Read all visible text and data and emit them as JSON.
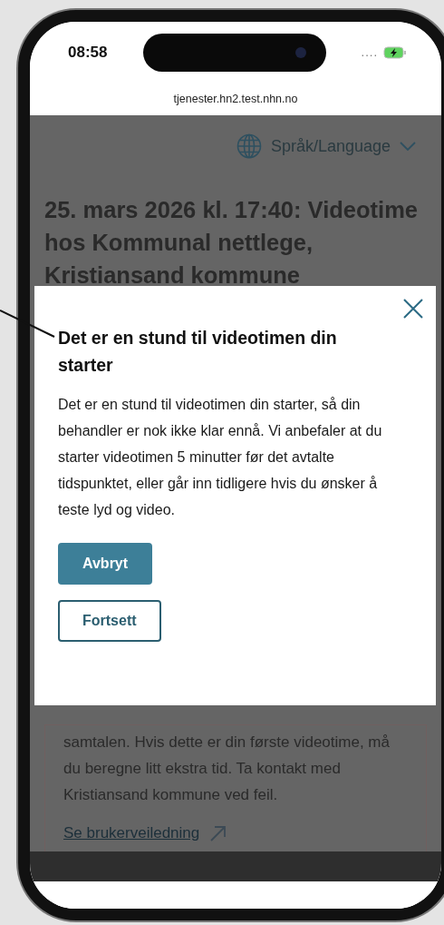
{
  "status_bar": {
    "time": "08:58",
    "signal": "...."
  },
  "browser": {
    "url": "tjenester.hn2.test.nhn.no"
  },
  "page": {
    "language_button": {
      "label": "Språk/Language"
    },
    "heading": "25. mars 2026 kl. 17:40: Videotime hos Kommunal nettlege, Kristiansand kommune",
    "info_text": "samtalen. Hvis dette er din første videotime, må du beregne litt ekstra tid. Ta kontakt med Kristiansand kommune ved feil.",
    "link": "Se brukerveiledning"
  },
  "dialog": {
    "title": "Det er en stund til videotimen din starter",
    "body": "Det er en stund til videotimen din starter, så din behandler er nok ikke klar ennå. Vi anbefaler at du starter videotimen 5 minutter før det avtalte tidspunktet, eller går inn tidligere hvis du ønsker å teste lyd og video.",
    "buttons": [
      {
        "label": "Avbryt",
        "kind": "primary"
      },
      {
        "label": "Fortsett",
        "kind": "secondary"
      }
    ]
  }
}
